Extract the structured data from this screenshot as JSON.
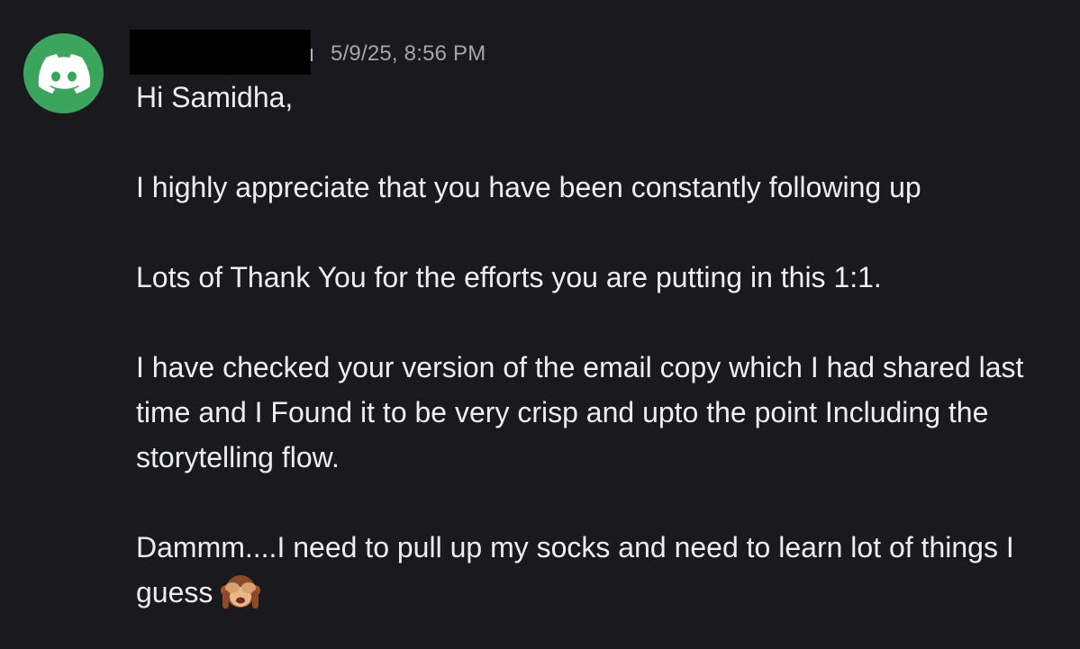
{
  "message": {
    "timestamp": "5/9/25, 8:56 PM",
    "greeting": "Hi Samidha,",
    "paragraphs": [
      "I highly appreciate that you have been constantly following up",
      "Lots of Thank You for the efforts you are putting in this 1:1.",
      "I have checked your version of the email copy which I had shared last time and I Found it to be very crisp and upto the point Including the storytelling flow.",
      "Dammm....I need to pull up my socks and need to learn lot of things I guess"
    ],
    "trailing_emoji": "see-no-evil-monkey-icon"
  },
  "colors": {
    "background": "#1a1a1e",
    "avatar": "#3ba55d",
    "text": "#eceef1",
    "timestamp": "#a3a6ad"
  }
}
